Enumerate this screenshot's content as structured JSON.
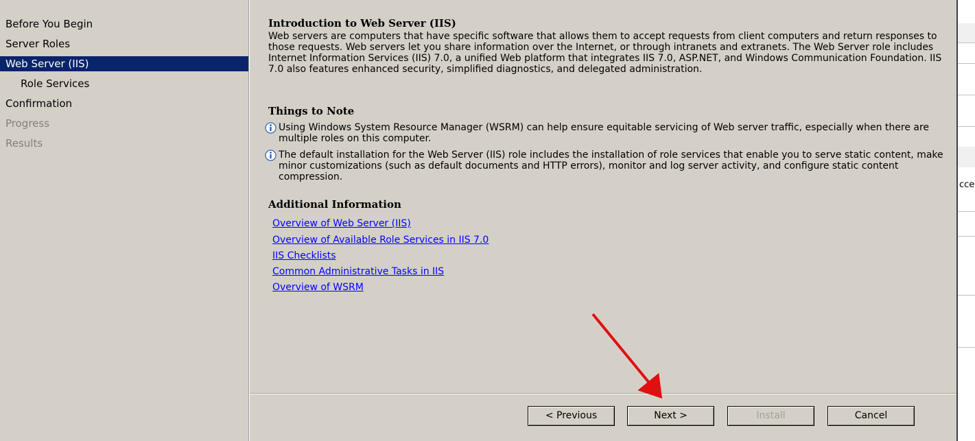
{
  "nav": {
    "items": [
      {
        "label": "Before You Begin",
        "state": "normal"
      },
      {
        "label": "Server Roles",
        "state": "normal"
      },
      {
        "label": "Web Server (IIS)",
        "state": "selected"
      },
      {
        "label": "Role Services",
        "state": "sub"
      },
      {
        "label": "Confirmation",
        "state": "normal"
      },
      {
        "label": "Progress",
        "state": "disabled"
      },
      {
        "label": "Results",
        "state": "disabled"
      }
    ]
  },
  "main": {
    "intro_heading": "Introduction to Web Server (IIS)",
    "intro_text": "Web servers are computers that have specific software that allows them to accept requests from client computers and return responses to those requests. Web servers let you share information over the Internet, or through intranets and extranets. The Web Server role includes Internet Information Services (IIS) 7.0, a unified Web platform that integrates IIS 7.0, ASP.NET, and Windows Communication Foundation. IIS 7.0 also features enhanced security, simplified diagnostics, and delegated administration.",
    "notes_heading": "Things to Note",
    "notes": [
      "Using Windows System Resource Manager (WSRM) can help ensure equitable servicing of Web server traffic, especially when there are multiple roles on this computer.",
      "The default installation for the Web Server (IIS) role includes the installation of role services that enable you to serve static content, make minor customizations (such as default documents and HTTP errors), monitor and log server activity, and configure static content compression."
    ],
    "additional_heading": "Additional Information",
    "links": [
      "Overview of Web Server (IIS)",
      "Overview of Available Role Services in IIS 7.0",
      "IIS Checklists",
      "Common Administrative Tasks in IIS",
      "Overview of WSRM"
    ]
  },
  "buttons": {
    "previous": "< Previous",
    "next": "Next >",
    "install": "Install",
    "cancel": "Cancel"
  },
  "background_window": {
    "partial_text": "cce"
  },
  "colors": {
    "selected_bg": "#0a246a",
    "arrow": "#e01010",
    "link": "#0000ff",
    "dialog_bg": "#d4d0c8"
  },
  "icons": {
    "note_icon": "info-icon"
  }
}
